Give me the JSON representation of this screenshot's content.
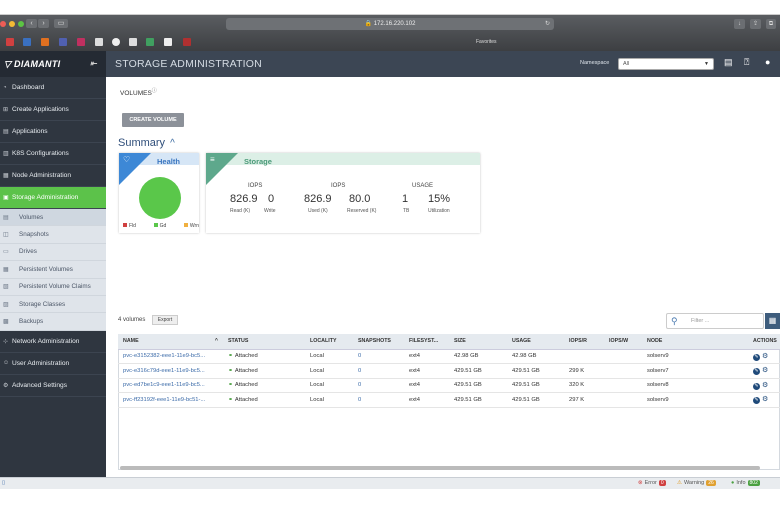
{
  "browser": {
    "url": "172.16.220.102",
    "favorites_label": "Favorites"
  },
  "app": {
    "brand": "DIAMANTI",
    "page_title": "STORAGE ADMINISTRATION",
    "namespace_label": "Namespace",
    "namespace_value": "All"
  },
  "sidebar": {
    "items": [
      {
        "label": "Dashboard"
      },
      {
        "label": "Create Applications"
      },
      {
        "label": "Applications"
      },
      {
        "label": "K8S Configurations"
      },
      {
        "label": "Node Administration"
      },
      {
        "label": "Storage Administration"
      }
    ],
    "sub_items": [
      {
        "label": "Volumes"
      },
      {
        "label": "Snapshots"
      },
      {
        "label": "Drives"
      },
      {
        "label": "Persistent Volumes"
      },
      {
        "label": "Persistent Volume Claims"
      },
      {
        "label": "Storage Classes"
      },
      {
        "label": "Backups"
      }
    ],
    "bottom_items": [
      {
        "label": "Network Administration"
      },
      {
        "label": "User Administration"
      },
      {
        "label": "Advanced Settings"
      }
    ]
  },
  "main": {
    "heading": "VOLUMES",
    "create_button": "CREATE VOLUME",
    "summary_heading": "Summary",
    "health": {
      "title": "Health",
      "legend": [
        "Fld",
        "Gd",
        "Wrn"
      ]
    },
    "storage": {
      "title": "Storage",
      "iops1_header": "IOPS",
      "iops1_read": "826.9",
      "iops1_read_label": "Read (K)",
      "iops1_write": "0",
      "iops1_write_label": "Write",
      "iops2_header": "IOPS",
      "iops2_used": "826.9",
      "iops2_used_label": "Used (K)",
      "iops2_reserved": "80.0",
      "iops2_reserved_label": "Reserved (K)",
      "usage_header": "USAGE",
      "usage_tb": "1",
      "usage_tb_label": "TB",
      "usage_util": "15%",
      "usage_util_label": "Utilization"
    },
    "volume_count": "4 volumes",
    "export_button": "Export",
    "filter_placeholder": "Filter ...",
    "table": {
      "headers": [
        "NAME",
        "STATUS",
        "LOCALITY",
        "SNAPSHOTS",
        "FILESYST...",
        "SIZE",
        "USAGE",
        "IOPS/R",
        "IOPS/W",
        "NODE",
        "ACTIONS"
      ],
      "rows": [
        {
          "name": "pvc-e3152382-eee1-11e9-bc5...",
          "status": "Attached",
          "locality": "Local",
          "snapshots": "0",
          "fs": "ext4",
          "size": "42.98 GB",
          "usage": "42.98 GB",
          "iops_r": "",
          "iops_w": "",
          "node": "solserv9"
        },
        {
          "name": "pvc-e316c79d-eee1-11e9-bc5...",
          "status": "Attached",
          "locality": "Local",
          "snapshots": "0",
          "fs": "ext4",
          "size": "429.51 GB",
          "usage": "429.51 GB",
          "iops_r": "299 K",
          "iops_w": "",
          "node": "solserv7"
        },
        {
          "name": "pvc-ed7be1c9-eee1-11e9-bc5...",
          "status": "Attached",
          "locality": "Local",
          "snapshots": "0",
          "fs": "ext4",
          "size": "429.51 GB",
          "usage": "429.51 GB",
          "iops_r": "320 K",
          "iops_w": "",
          "node": "solserv8"
        },
        {
          "name": "pvc-ff23192f-eee1-11e9-bc51-...",
          "status": "Attached",
          "locality": "Local",
          "snapshots": "0",
          "fs": "ext4",
          "size": "429.51 GB",
          "usage": "429.51 GB",
          "iops_r": "297 K",
          "iops_w": "",
          "node": "solserv9"
        }
      ]
    }
  },
  "statusbar": {
    "error_label": "Error",
    "error_count": "0",
    "warning_label": "Warning",
    "warning_count": "26",
    "info_label": "Info",
    "info_count": "802"
  },
  "colors": {
    "sidebar_bg": "#2f3640",
    "active_green": "#5cc24a",
    "health_blue": "#3d88d6",
    "storage_green": "#5ea88c"
  }
}
